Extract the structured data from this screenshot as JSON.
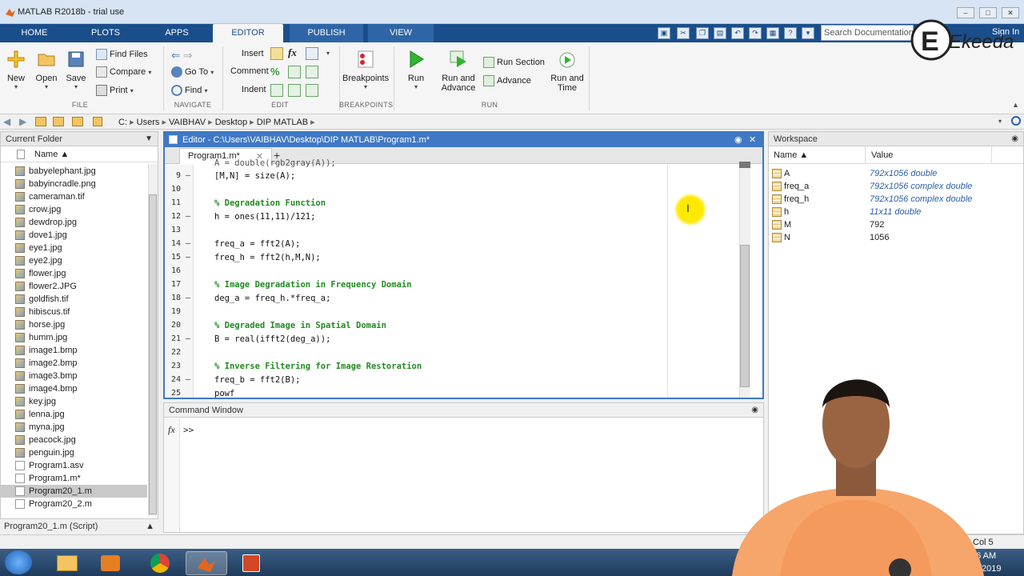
{
  "window": {
    "title": "MATLAB R2018b - trial use"
  },
  "tabs": [
    {
      "label": "HOME"
    },
    {
      "label": "PLOTS"
    },
    {
      "label": "APPS"
    },
    {
      "label": "EDITOR",
      "active": true
    },
    {
      "label": "PUBLISH"
    },
    {
      "label": "VIEW"
    }
  ],
  "search": {
    "placeholder": "Search Documentation"
  },
  "sign_in": "Sign In",
  "ribbon": {
    "file": {
      "new": "New",
      "open": "Open",
      "save": "Save",
      "find_files": "Find Files",
      "compare": "Compare",
      "print": "Print",
      "label": "FILE"
    },
    "navigate": {
      "go_to": "Go To",
      "find": "Find",
      "label": "NAVIGATE"
    },
    "edit": {
      "insert": "Insert",
      "comment": "Comment",
      "indent": "Indent",
      "fx": "fx",
      "label": "EDIT"
    },
    "breakpoints": {
      "breakpoints": "Breakpoints",
      "label": "BREAKPOINTS"
    },
    "run": {
      "run": "Run",
      "run_and_advance_1": "Run and",
      "run_and_advance_2": "Advance",
      "run_section": "Run Section",
      "advance": "Advance",
      "run_and_time_1": "Run and",
      "run_and_time_2": "Time",
      "label": "RUN"
    }
  },
  "address": {
    "drive": "C:",
    "parts": [
      "Users",
      "VAIBHAV",
      "Desktop",
      "DIP MATLAB"
    ]
  },
  "current_folder": {
    "title": "Current Folder",
    "col_name": "Name ▲",
    "files": [
      "babyelephant.jpg",
      "babyincradle.png",
      "cameraman.tif",
      "crow.jpg",
      "dewdrop.jpg",
      "dove1.jpg",
      "eye1.jpg",
      "eye2.jpg",
      "flower.jpg",
      "flower2.JPG",
      "goldfish.tif",
      "hibiscus.tif",
      "horse.jpg",
      "humm.jpg",
      "image1.bmp",
      "image2.bmp",
      "image3.bmp",
      "image4.bmp",
      "key.jpg",
      "lenna.jpg",
      "myna.jpg",
      "peacock.jpg",
      "penguin.jpg",
      "Program1.asv",
      "Program1.m*",
      "Program20_1.m",
      "Program20_2.m"
    ],
    "selected": "Program20_1.m",
    "status": "Program20_1.m  (Script)"
  },
  "editor": {
    "title": "Editor - C:\\Users\\VAIBHAV\\Desktop\\DIP MATLAB\\Program1.m*",
    "tab": "Program1.m*",
    "lines": [
      {
        "n": "9",
        "dash": true,
        "text": "[M,N] = size(A);",
        "comment": false
      },
      {
        "n": "10",
        "dash": false,
        "text": "",
        "comment": false
      },
      {
        "n": "11",
        "dash": false,
        "text": "% Degradation Function",
        "comment": true
      },
      {
        "n": "12",
        "dash": true,
        "text": "h = ones(11,11)/121;",
        "comment": false
      },
      {
        "n": "13",
        "dash": false,
        "text": "",
        "comment": false
      },
      {
        "n": "14",
        "dash": true,
        "text": "freq_a = fft2(A);",
        "comment": false
      },
      {
        "n": "15",
        "dash": true,
        "text": "freq_h = fft2(h,M,N);",
        "comment": false
      },
      {
        "n": "16",
        "dash": false,
        "text": "",
        "comment": false
      },
      {
        "n": "17",
        "dash": false,
        "text": "% Image Degradation in Frequency Domain",
        "comment": true
      },
      {
        "n": "18",
        "dash": true,
        "text": "deg_a = freq_h.*freq_a;",
        "comment": false
      },
      {
        "n": "19",
        "dash": false,
        "text": "",
        "comment": false
      },
      {
        "n": "20",
        "dash": false,
        "text": "% Degraded Image in Spatial Domain",
        "comment": true
      },
      {
        "n": "21",
        "dash": true,
        "text": "B = real(ifft2(deg_a));",
        "comment": false
      },
      {
        "n": "22",
        "dash": false,
        "text": "",
        "comment": false
      },
      {
        "n": "23",
        "dash": false,
        "text": "% Inverse Filtering for Image Restoration",
        "comment": true
      },
      {
        "n": "24",
        "dash": true,
        "text": "freq_b = fft2(B);",
        "comment": false
      },
      {
        "n": "25",
        "dash": false,
        "text": "powf",
        "comment": false
      }
    ],
    "partial_top": "A = double(rgb2gray(A));"
  },
  "command_window": {
    "title": "Command Window",
    "prompt": ">>",
    "fx": "fx"
  },
  "workspace": {
    "title": "Workspace",
    "col_name": "Name ▲",
    "col_value": "Value",
    "vars": [
      {
        "name": "A",
        "value": "792x1056 double",
        "italic": true
      },
      {
        "name": "freq_a",
        "value": "792x1056 complex double",
        "italic": true
      },
      {
        "name": "freq_h",
        "value": "792x1056 complex double",
        "italic": true
      },
      {
        "name": "h",
        "value": "11x11 double",
        "italic": true
      },
      {
        "name": "M",
        "value": "792",
        "italic": false
      },
      {
        "name": "N",
        "value": "1056",
        "italic": false
      }
    ]
  },
  "status": {
    "col": "Col  5"
  },
  "taskbar": {
    "time": "16 AM",
    "date": "/2019"
  },
  "watermark": "Ekeeda"
}
